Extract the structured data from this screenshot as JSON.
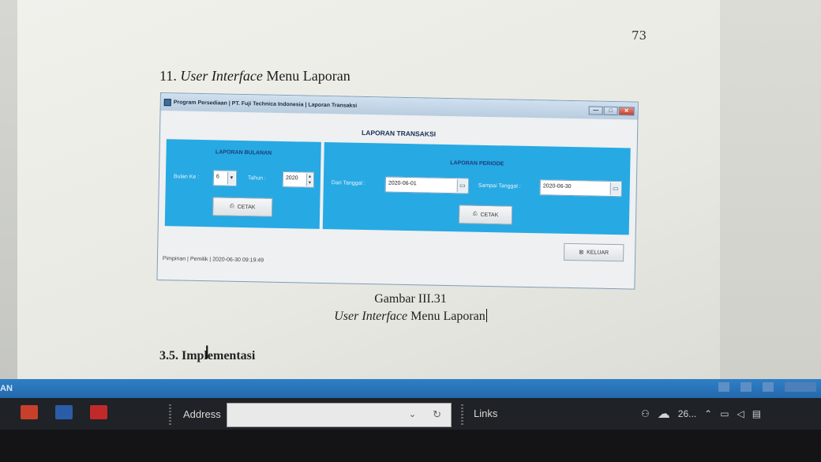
{
  "document": {
    "page_number": "73",
    "heading_number": "11.",
    "heading_italic": "User Interface",
    "heading_rest": "Menu Laporan",
    "caption_line1": "Gambar III.31",
    "caption_italic": "User Interface",
    "caption_rest": "Menu Laporan",
    "section_heading": "3.5. Implementasi"
  },
  "app_window": {
    "title": "Program Persediaan | PT. Fuji Technica Indonesia | Laporan Transaksi",
    "min_glyph": "—",
    "max_glyph": "□",
    "close_glyph": "✕",
    "heading": "LAPORAN TRANSAKSI",
    "monthly": {
      "title": "LAPORAN BULANAN",
      "month_label": "Bulan Ke :",
      "month_value": "6",
      "year_label": "Tahun :",
      "year_value": "2020",
      "print_button": "CETAK"
    },
    "period": {
      "title": "LAPORAN PERIODE",
      "from_label": "Dari Tanggal :",
      "from_value": "2020-06-01",
      "to_label": "Sampai Tanggal :",
      "to_value": "2020-06-30",
      "print_button": "CETAK"
    },
    "exit_button": "KELUAR",
    "status_text": "Pimpinan | Pemilik | 2020-06-30 09:19:49",
    "panel_color": "#27a9e3"
  },
  "screen": {
    "window_bar_text": "AN",
    "address_label": "Address",
    "address_value": "",
    "links_label": "Links",
    "tray_temp": "26..."
  }
}
